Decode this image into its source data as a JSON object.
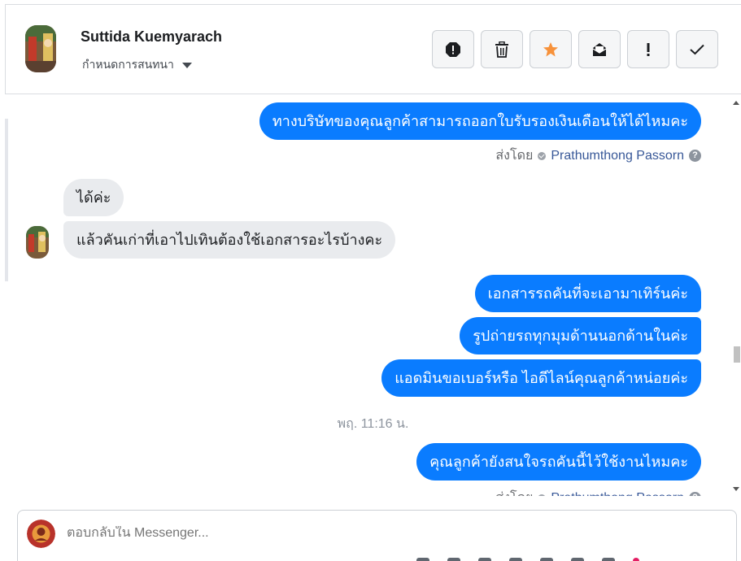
{
  "header": {
    "contact_name": "Suttida Kuemyarach",
    "assign_label": "กำหนดการสนทนา",
    "actions": [
      {
        "name": "spam-button",
        "icon": "alert-octagon-icon"
      },
      {
        "name": "delete-button",
        "icon": "trash-icon"
      },
      {
        "name": "star-button",
        "icon": "star-icon",
        "active": true
      },
      {
        "name": "mark-unread-button",
        "icon": "envelope-open-icon"
      },
      {
        "name": "follow-up-button",
        "icon": "exclamation-icon"
      },
      {
        "name": "done-button",
        "icon": "check-icon"
      }
    ]
  },
  "messages": {
    "m1": "ทางบริษัทของคุณลูกค้าสามารถออกใบรับรองเงินเดือนให้ได้ไหมคะ",
    "sent_by_label": "ส่งโดย",
    "sender_name": "Prathumthong Passorn",
    "m2": "ได้ค่ะ",
    "m3": "แล้วคันเก่าที่เอาไปเทินต้องใช้เอกสารอะไรบ้างคะ",
    "m4": "เอกสารรถคันที่จะเอามาเทิร์นค่ะ",
    "m5": "รูปถ่ายรถทุกมุมด้านนอกด้านในค่ะ",
    "m6": "แอดมินขอเบอร์หรือ ไอดีไลน์คุณลูกค้าหน่อยค่ะ",
    "timestamp": "พฤ. 11:16 น.",
    "m7": "คุณลูกค้ายังสนใจรถคันนี้ไว้ใช้งานไหมคะ"
  },
  "reply": {
    "placeholder": "ตอบกลับใน Messenger..."
  },
  "colors": {
    "outgoing_bubble": "#0a7cff",
    "incoming_bubble": "#e9ebee",
    "star_active": "#f7923b",
    "link_name": "#385898"
  }
}
